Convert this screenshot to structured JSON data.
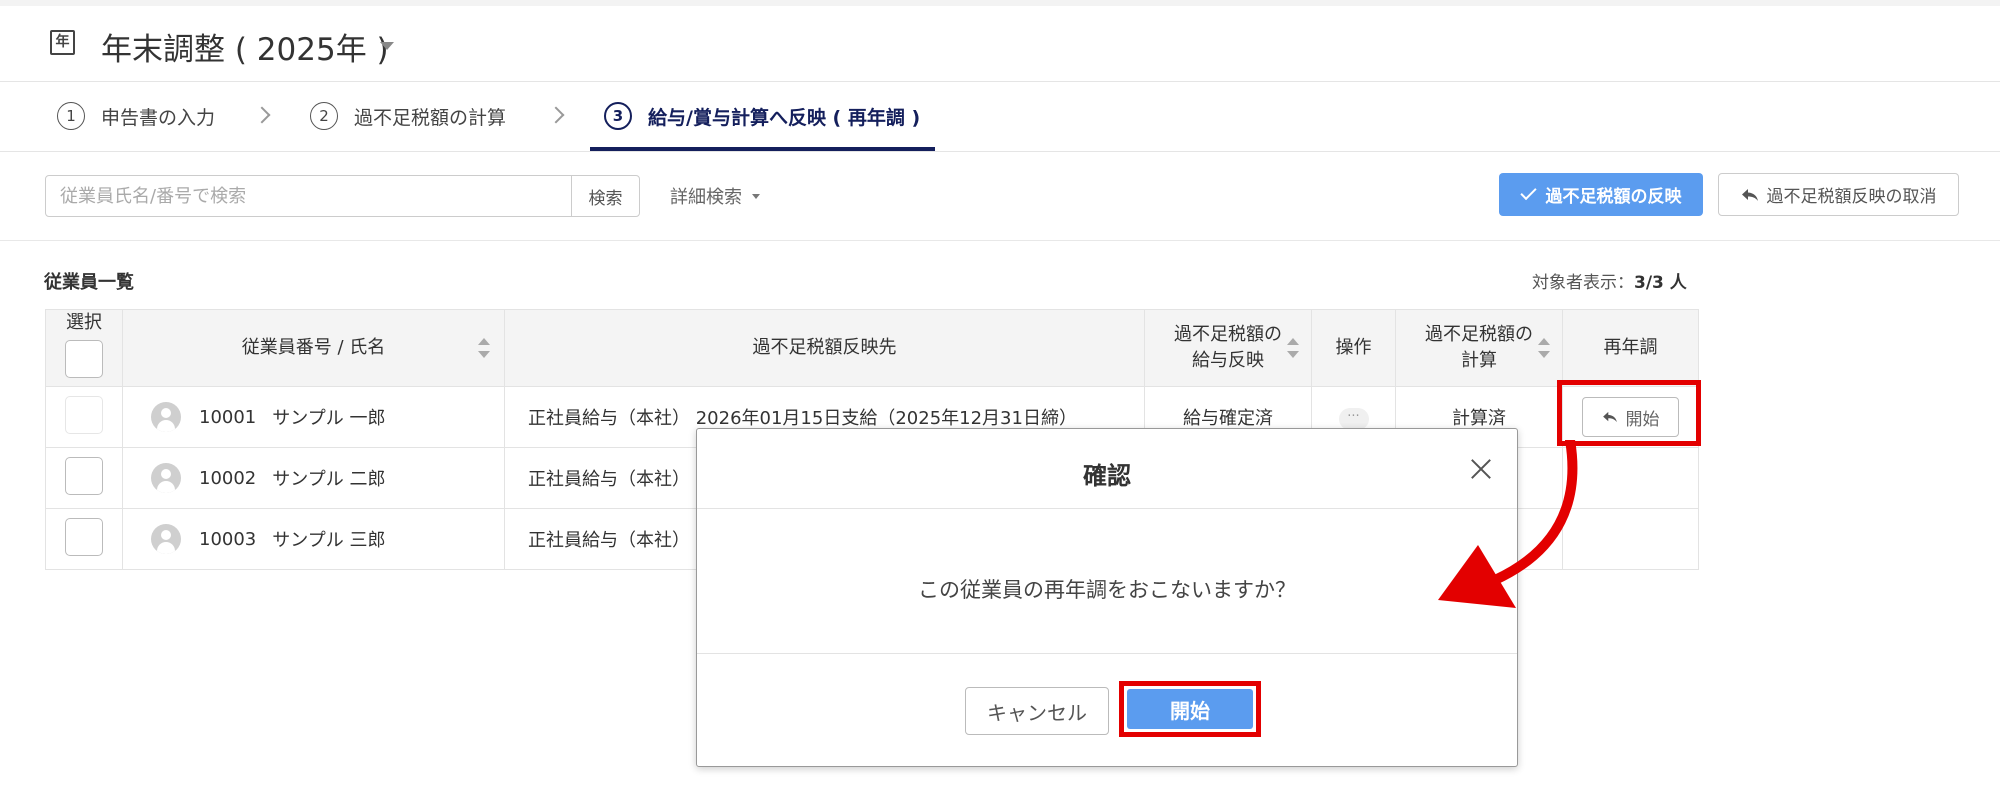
{
  "header": {
    "year_icon": "年",
    "title": "年末調整 ( 2025年 )"
  },
  "steps": [
    {
      "num": "1",
      "label": "申告書の入力"
    },
    {
      "num": "2",
      "label": "過不足税額の計算"
    },
    {
      "num": "3",
      "label": "給与/賞与計算へ反映 ( 再年調 )"
    }
  ],
  "toolbar": {
    "search_placeholder": "従業員氏名/番号で検索",
    "search_button": "検索",
    "advanced_search": "詳細検索",
    "reflect_button": "過不足税額の反映",
    "cancel_reflect_button": "過不足税額反映の取消"
  },
  "list": {
    "title": "従業員一覧",
    "count_label": "対象者表示：",
    "count_value": "3/3 人"
  },
  "table": {
    "headers": {
      "select": "選択",
      "employee": "従業員番号 / 氏名",
      "destination": "過不足税額反映先",
      "reflect_line1": "過不足税額の",
      "reflect_line2": "給与反映",
      "ops": "操作",
      "calc_line1": "過不足税額の",
      "calc_line2": "計算",
      "readjust": "再年調"
    },
    "rows": [
      {
        "no": "10001",
        "name": "サンプル 一郎",
        "destination": "正社員給与（本社） 2026年01月15日支給（2025年12月31日締）",
        "reflect": "給与確定済",
        "ops": "···",
        "calc": "計算済",
        "action": "開始"
      },
      {
        "no": "10002",
        "name": "サンプル 二郎",
        "destination": "正社員給与（本社）"
      },
      {
        "no": "10003",
        "name": "サンプル 三郎",
        "destination": "正社員給与（本社）"
      }
    ]
  },
  "dialog": {
    "title": "確認",
    "message": "この従業員の再年調をおこないますか？",
    "cancel_button": "キャンセル",
    "start_button": "開始"
  },
  "colors": {
    "accent": "#5b9cef",
    "navy": "#141f5c",
    "highlight": "#e30000",
    "link": "#2a6fd1"
  }
}
